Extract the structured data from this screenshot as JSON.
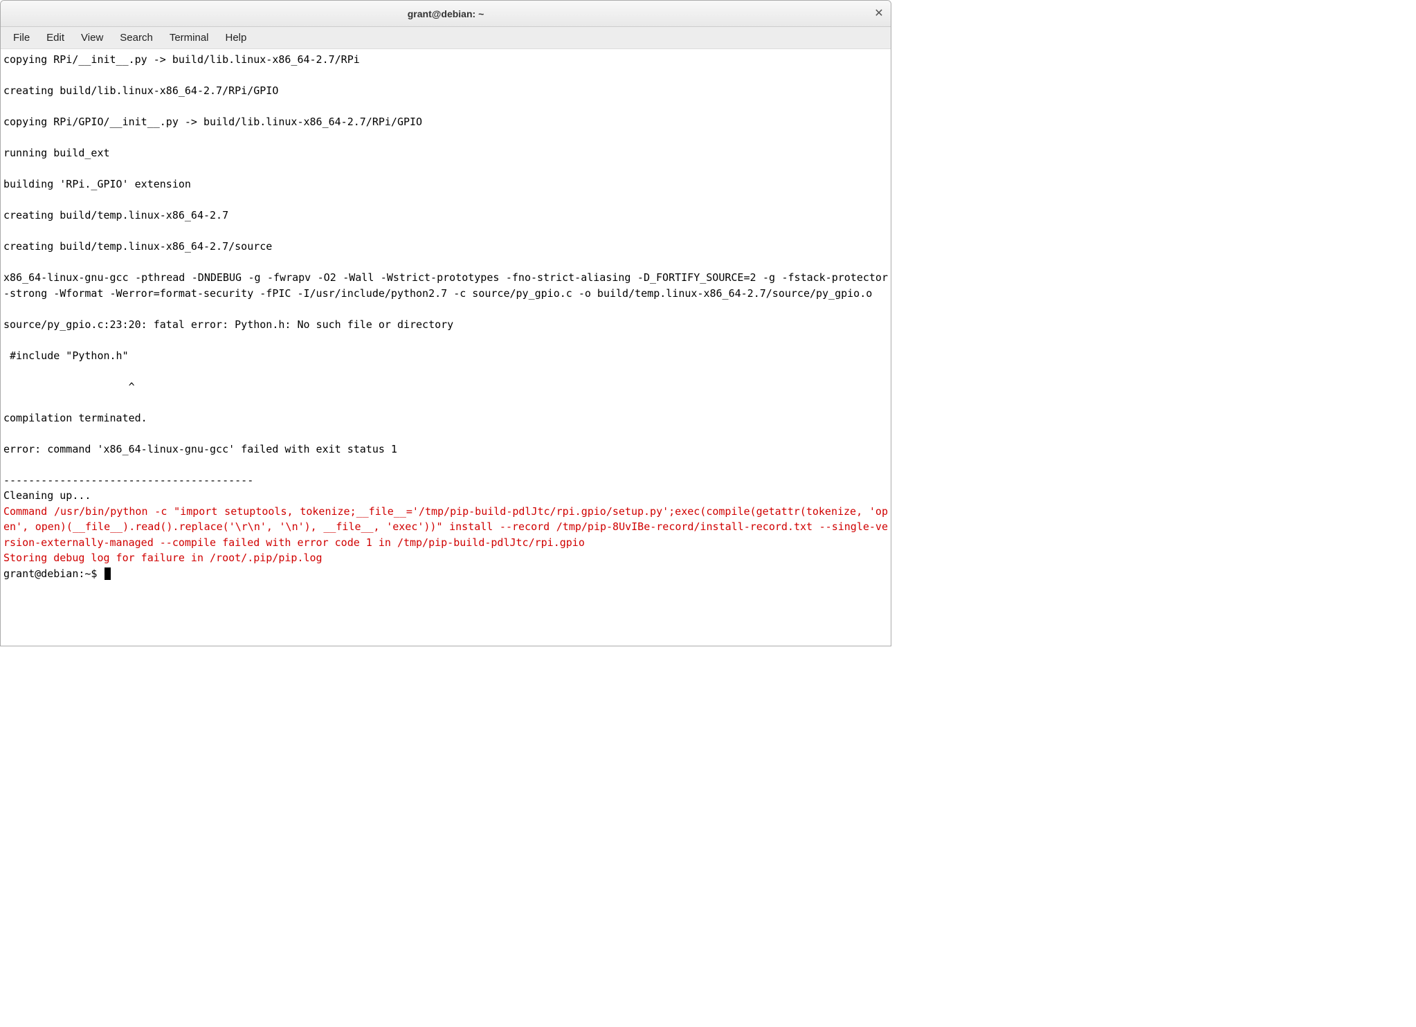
{
  "window": {
    "title": "grant@debian: ~"
  },
  "menubar": {
    "items": [
      "File",
      "Edit",
      "View",
      "Search",
      "Terminal",
      "Help"
    ]
  },
  "terminal": {
    "lines": [
      {
        "text": "copying RPi/__init__.py -> build/lib.linux-x86_64-2.7/RPi"
      },
      {
        "text": ""
      },
      {
        "text": "creating build/lib.linux-x86_64-2.7/RPi/GPIO"
      },
      {
        "text": ""
      },
      {
        "text": "copying RPi/GPIO/__init__.py -> build/lib.linux-x86_64-2.7/RPi/GPIO"
      },
      {
        "text": ""
      },
      {
        "text": "running build_ext"
      },
      {
        "text": ""
      },
      {
        "text": "building 'RPi._GPIO' extension"
      },
      {
        "text": ""
      },
      {
        "text": "creating build/temp.linux-x86_64-2.7"
      },
      {
        "text": ""
      },
      {
        "text": "creating build/temp.linux-x86_64-2.7/source"
      },
      {
        "text": ""
      },
      {
        "text": "x86_64-linux-gnu-gcc -pthread -DNDEBUG -g -fwrapv -O2 -Wall -Wstrict-prototypes -fno-strict-aliasing -D_FORTIFY_SOURCE=2 -g -fstack-protector-strong -Wformat -Werror=format-security -fPIC -I/usr/include/python2.7 -c source/py_gpio.c -o build/temp.linux-x86_64-2.7/source/py_gpio.o",
        "class": "gcc-line"
      },
      {
        "text": ""
      },
      {
        "text": "source/py_gpio.c:23:20: fatal error: Python.h: No such file or directory"
      },
      {
        "text": ""
      },
      {
        "text": " #include \"Python.h\""
      },
      {
        "text": ""
      },
      {
        "text": "                    ^"
      },
      {
        "text": ""
      },
      {
        "text": "compilation terminated."
      },
      {
        "text": ""
      },
      {
        "text": "error: command 'x86_64-linux-gnu-gcc' failed with exit status 1"
      },
      {
        "text": ""
      },
      {
        "text": "----------------------------------------"
      },
      {
        "text": "Cleaning up..."
      },
      {
        "text": "Command /usr/bin/python -c \"import setuptools, tokenize;__file__='/tmp/pip-build-pdlJtc/rpi.gpio/setup.py';exec(compile(getattr(tokenize, 'open', open)(__file__).read().replace('\\r\\n', '\\n'), __file__, 'exec'))\" install --record /tmp/pip-8UvIBe-record/install-record.txt --single-version-externally-managed --compile failed with error code 1 in /tmp/pip-build-pdlJtc/rpi.gpio",
        "class": "red gcc-line"
      },
      {
        "text": "Storing debug log for failure in /root/.pip/pip.log",
        "class": "red"
      }
    ],
    "prompt": "grant@debian:~$ "
  }
}
